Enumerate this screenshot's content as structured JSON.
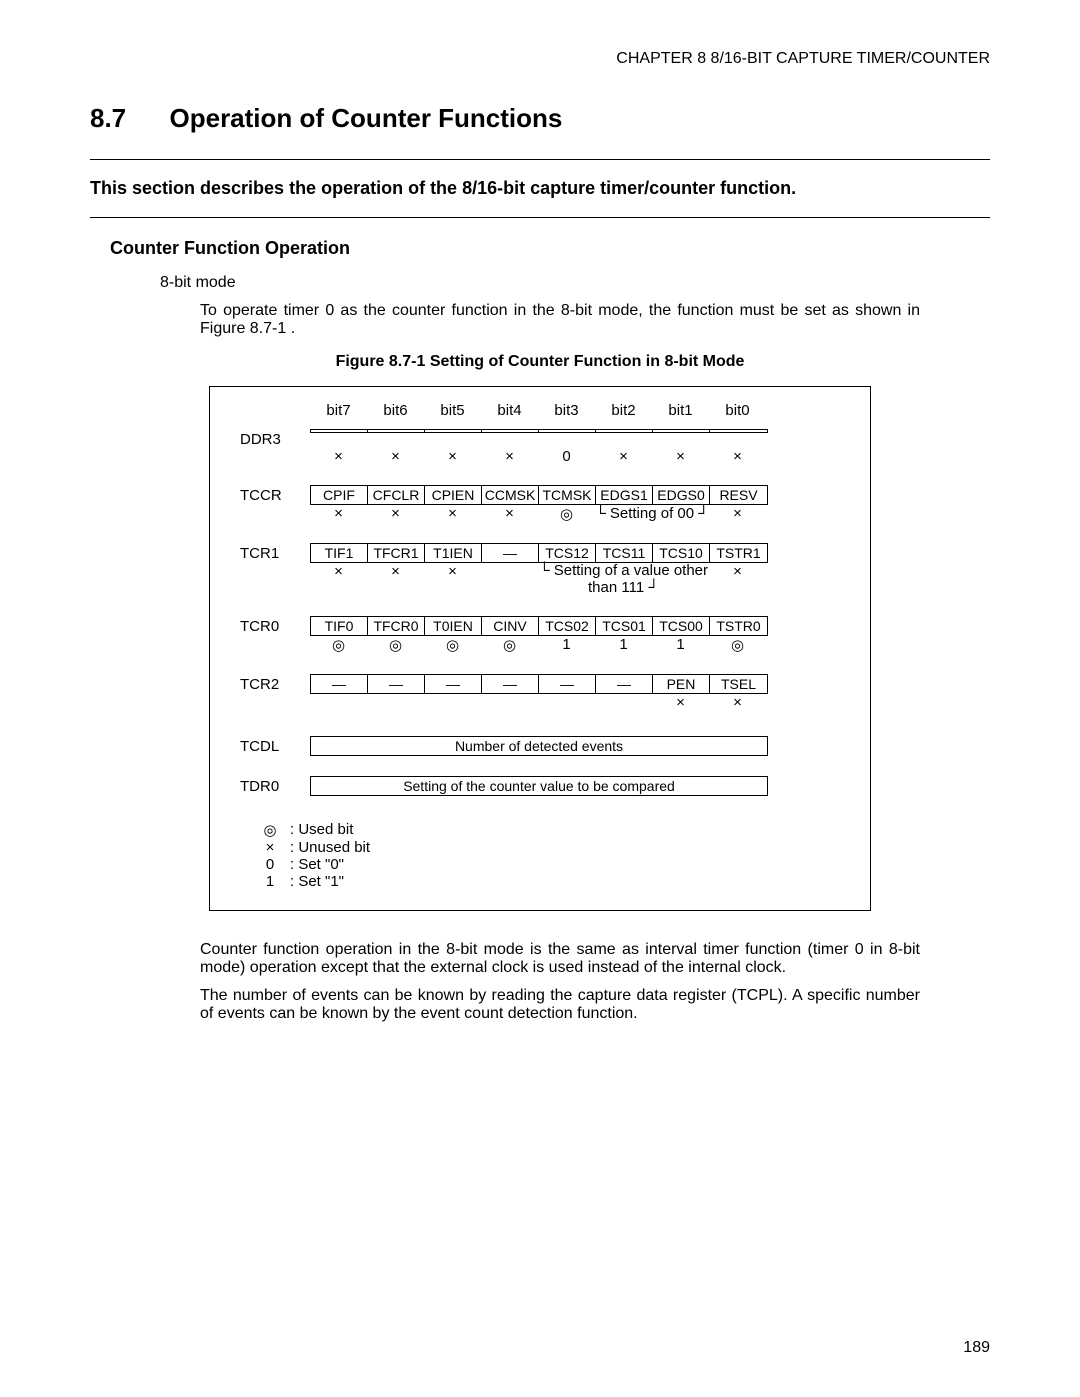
{
  "chapter_header": "CHAPTER 8  8/16-BIT CAPTURE TIMER/COUNTER",
  "section_number": "8.7",
  "section_title": "Operation of Counter Functions",
  "intro": "This section describes the operation of the 8/16-bit capture timer/counter function.",
  "sub_title": "Counter Function Operation",
  "mode_label": "8-bit mode",
  "body1": "To operate timer 0 as the counter function in the 8-bit mode, the function must be set as shown in Figure 8.7-1 .",
  "fig_caption": "Figure 8.7-1  Setting of Counter Function in 8-bit Mode",
  "bits": [
    "bit7",
    "bit6",
    "bit5",
    "bit4",
    "bit3",
    "bit2",
    "bit1",
    "bit0"
  ],
  "registers": {
    "ddr3": {
      "label": "DDR3",
      "cells": [
        "",
        "",
        "",
        "",
        "",
        "",
        "",
        ""
      ],
      "below": [
        "×",
        "×",
        "×",
        "×",
        "0",
        "×",
        "×",
        "×"
      ]
    },
    "tccr": {
      "label": "TCCR",
      "cells": [
        "CPIF",
        "CFCLR",
        "CPIEN",
        "CCMSK",
        "TCMSK",
        "EDGS1",
        "EDGS0",
        "RESV"
      ],
      "below": [
        "×",
        "×",
        "×",
        "×",
        "◎",
        "",
        "",
        "×"
      ],
      "note": "Setting of 00"
    },
    "tcr1": {
      "label": "TCR1",
      "cells": [
        "TIF1",
        "TFCR1",
        "T1IEN",
        "—",
        "TCS12",
        "TCS11",
        "TCS10",
        "TSTR1"
      ],
      "below": [
        "×",
        "×",
        "×",
        "",
        "",
        "",
        "",
        "×"
      ],
      "note": "Setting of a value other than 111"
    },
    "tcr0": {
      "label": "TCR0",
      "cells": [
        "TIF0",
        "TFCR0",
        "T0IEN",
        "CINV",
        "TCS02",
        "TCS01",
        "TCS00",
        "TSTR0"
      ],
      "below": [
        "◎",
        "◎",
        "◎",
        "◎",
        "1",
        "1",
        "1",
        "◎"
      ]
    },
    "tcr2": {
      "label": "TCR2",
      "cells": [
        "—",
        "—",
        "—",
        "—",
        "—",
        "—",
        "PEN",
        "TSEL"
      ],
      "below": [
        "",
        "",
        "",
        "",
        "",
        "",
        "×",
        "×"
      ]
    },
    "tcdl": {
      "label": "TCDL",
      "full": "Number of detected events"
    },
    "tdr0": {
      "label": "TDR0",
      "full": "Setting of the counter value to be compared"
    }
  },
  "legend": [
    {
      "sym": "◎",
      "text": ": Used bit"
    },
    {
      "sym": "×",
      "text": ": Unused bit"
    },
    {
      "sym": "0",
      "text": ": Set \"0\""
    },
    {
      "sym": "1",
      "text": ": Set \"1\""
    }
  ],
  "body2": "Counter function operation in the 8-bit mode is the same as interval timer function (timer 0 in 8-bit mode) operation except that the external clock is used instead of the internal clock.",
  "body3": "The number of events can be known by reading the capture data register (TCPL). A specific number of events can be known by the event count detection function.",
  "page_number": "189"
}
